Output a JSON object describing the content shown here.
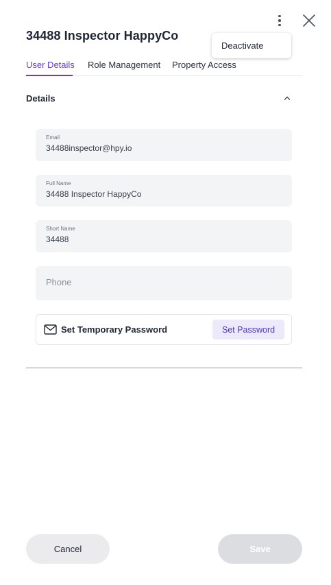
{
  "header": {
    "title": "34488 Inspector HappyCo",
    "more_icon": "kebab-vertical-icon",
    "close_icon": "close-x-icon"
  },
  "more_menu": {
    "items": [
      {
        "label": "Deactivate"
      }
    ]
  },
  "tabs": [
    {
      "label": "User Details",
      "active": true
    },
    {
      "label": "Role Management",
      "active": false
    },
    {
      "label": "Property Access",
      "active": false
    }
  ],
  "details": {
    "section_title": "Details",
    "expanded": true,
    "fields": {
      "email": {
        "label": "Email",
        "value": "34488inspector@hpy.io"
      },
      "full_name": {
        "label": "Full Name",
        "value": "34488 Inspector HappyCo"
      },
      "short_name": {
        "label": "Short Name",
        "value": "34488"
      },
      "phone": {
        "placeholder": "Phone",
        "value": ""
      }
    },
    "temporary_password": {
      "label": "Set Temporary Password",
      "button_label": "Set Password",
      "icon": "mail-icon"
    }
  },
  "footer": {
    "cancel_label": "Cancel",
    "save_label": "Save",
    "save_disabled": true
  },
  "colors": {
    "accent": "#5b3fd6",
    "field_bg": "#f3f4f6",
    "set_password_bg": "#ece9fb",
    "save_disabled_bg": "#dcdde0"
  }
}
